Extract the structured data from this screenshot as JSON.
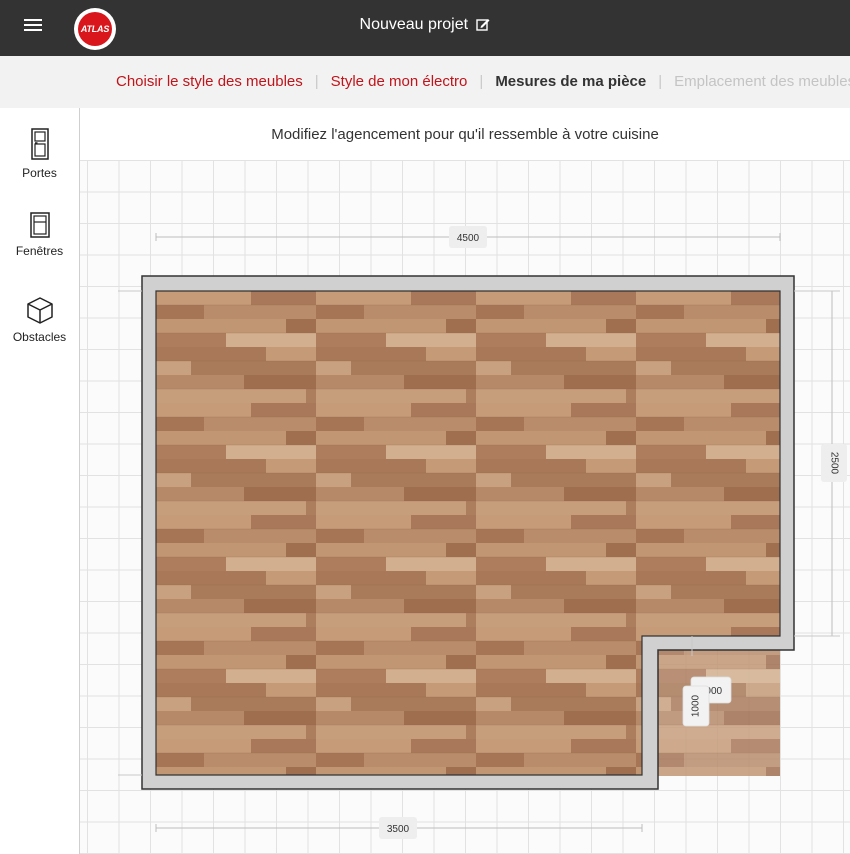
{
  "header": {
    "menu_icon": "hamburger-menu-icon",
    "logo_text": "ATLAS",
    "project_title": "Nouveau projet",
    "edit_icon": "pencil-edit-icon"
  },
  "steps": [
    {
      "label": "Choisir le style des meubles",
      "state": "done"
    },
    {
      "label": "Style de mon électro",
      "state": "done"
    },
    {
      "label": "Mesures de ma pièce",
      "state": "current"
    },
    {
      "label": "Emplacement des meubles",
      "state": "disabled"
    }
  ],
  "sidebar": {
    "items": [
      {
        "label": "Portes",
        "icon": "door-icon"
      },
      {
        "label": "Fenêtres",
        "icon": "window-icon"
      },
      {
        "label": "Obstacles",
        "icon": "cube-icon"
      }
    ]
  },
  "canvas": {
    "instruction": "Modifiez l'agencement pour qu'il ressemble à votre cuisine",
    "dimensions": {
      "top": "4500",
      "right": "2500",
      "bottom": "3500",
      "notch_width": "1000",
      "notch_height": "1000"
    }
  },
  "colors": {
    "topbar": "#333333",
    "accent": "#c0141b",
    "logo_red": "#d8161b",
    "wall": "#cfcfcf",
    "floor": "#b48565"
  }
}
